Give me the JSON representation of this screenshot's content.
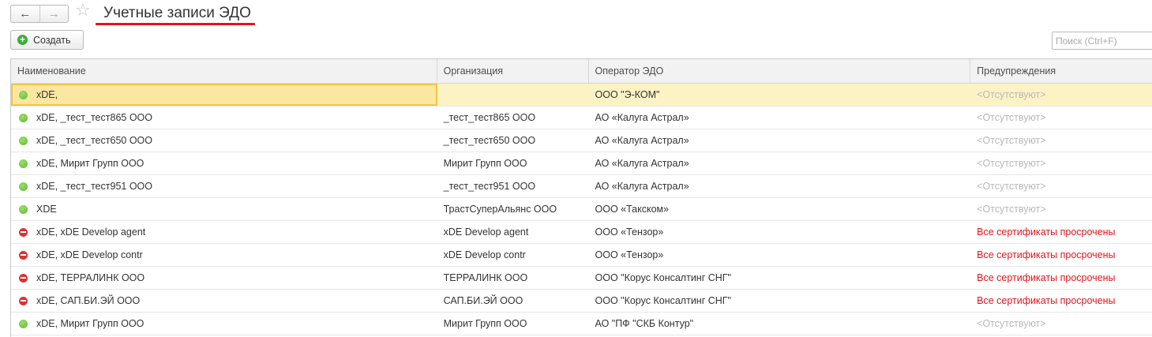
{
  "nav": {
    "back_label": "←",
    "forward_label": "→",
    "star": "☆"
  },
  "window": {
    "title": "Учетные записи ЭДО"
  },
  "toolbar": {
    "create_label": "Создать",
    "create_icon": "+"
  },
  "search": {
    "placeholder": "Поиск (Ctrl+F)"
  },
  "table": {
    "columns": [
      "Наименование",
      "Организация",
      "Оператор ЭДО",
      "Предупреждения"
    ],
    "rows": [
      {
        "status": "ok",
        "name": "xDE,",
        "org": "",
        "operator": "ООО \"Э-КОМ\"",
        "warning": "<Отсутствуют>",
        "warn_type": "none",
        "selected": true
      },
      {
        "status": "ok",
        "name": "xDE, _тест_тест865 ООО",
        "org": "_тест_тест865 ООО",
        "operator": "АО «Калуга Астрал»",
        "warning": "<Отсутствуют>",
        "warn_type": "none"
      },
      {
        "status": "ok",
        "name": "xDE, _тест_тест650 ООО",
        "org": "_тест_тест650 ООО",
        "operator": "АО «Калуга Астрал»",
        "warning": "<Отсутствуют>",
        "warn_type": "none"
      },
      {
        "status": "ok",
        "name": "xDE, Мирит Групп ООО",
        "org": "Мирит Групп ООО",
        "operator": "АО «Калуга Астрал»",
        "warning": "<Отсутствуют>",
        "warn_type": "none"
      },
      {
        "status": "ok",
        "name": "xDE, _тест_тест951 ООО",
        "org": "_тест_тест951 ООО",
        "operator": "АО «Калуга Астрал»",
        "warning": "<Отсутствуют>",
        "warn_type": "none"
      },
      {
        "status": "ok",
        "name": "XDE",
        "org": "ТрастСуперАльянс ООО",
        "operator": "ООО «Такском»",
        "warning": "<Отсутствуют>",
        "warn_type": "none"
      },
      {
        "status": "err",
        "name": "xDE, xDE Develop agent",
        "org": "xDE Develop agent",
        "operator": "ООО «Тензор»",
        "warning": "Все сертификаты просрочены",
        "warn_type": "err"
      },
      {
        "status": "err",
        "name": "xDE, xDE Develop contr",
        "org": "xDE Develop contr",
        "operator": "ООО «Тензор»",
        "warning": "Все сертификаты просрочены",
        "warn_type": "err"
      },
      {
        "status": "err",
        "name": "xDE, ТЕРРАЛИНК ООО",
        "org": "ТЕРРАЛИНК ООО",
        "operator": "ООО \"Корус Консалтинг СНГ\"",
        "warning": "Все сертификаты просрочены",
        "warn_type": "err"
      },
      {
        "status": "err",
        "name": "xDE, САП.БИ.ЭЙ ООО",
        "org": "САП.БИ.ЭЙ ООО",
        "operator": "ООО \"Корус Консалтинг СНГ\"",
        "warning": "Все сертификаты просрочены",
        "warn_type": "err"
      },
      {
        "status": "ok",
        "name": "xDE, Мирит Групп ООО",
        "org": "Мирит Групп ООО",
        "operator": "АО \"ПФ \"СКБ Контур\"",
        "warning": "<Отсутствуют>",
        "warn_type": "none"
      }
    ]
  },
  "colors": {
    "ok": "#5cb832",
    "error": "#dd3232",
    "selected_row": "#fcf3c4",
    "title_underline": "#e0151b"
  }
}
